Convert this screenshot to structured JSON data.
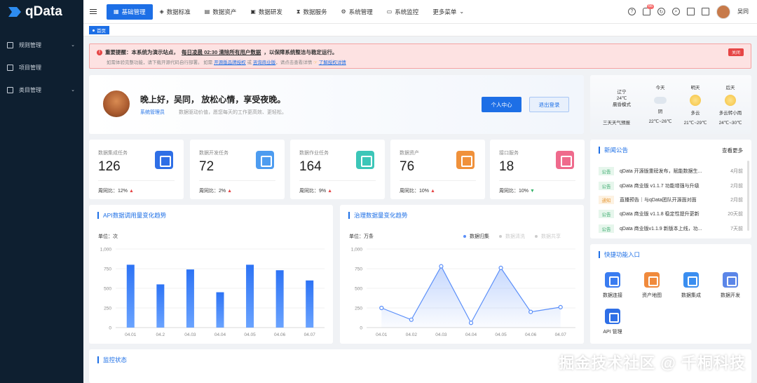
{
  "app": {
    "name": "qData"
  },
  "sidebar": {
    "items": [
      {
        "label": "规则管理",
        "has_children": true
      },
      {
        "label": "项目管理",
        "has_children": false
      },
      {
        "label": "类目管理",
        "has_children": true
      }
    ]
  },
  "topnav": {
    "items": [
      {
        "label": "基础管理",
        "icon": "grid-icon",
        "active": true
      },
      {
        "label": "数据标准",
        "icon": "layers-icon",
        "active": false
      },
      {
        "label": "数据资产",
        "icon": "database-icon",
        "active": false
      },
      {
        "label": "数据研发",
        "icon": "code-icon",
        "active": false
      },
      {
        "label": "数据服务",
        "icon": "hourglass-icon",
        "active": false
      },
      {
        "label": "系统管理",
        "icon": "settings-icon",
        "active": false
      },
      {
        "label": "系统监控",
        "icon": "monitor-icon",
        "active": false
      },
      {
        "label": "更多菜单",
        "icon": "chevron-down-icon",
        "active": false
      }
    ],
    "badge_count": "66",
    "user": "吴同"
  },
  "tags": {
    "home": "首页"
  },
  "alert": {
    "prefix": "重要提醒：本系统为演示站点，",
    "highlight": "每日凌晨 02:30 清除所有用户数据",
    "suffix": "，以保障系统整洁与稳定运行。",
    "line2_a": "如需体验完整功能，请下载开源代码自行部署。 如需",
    "link1": "开源版品牌授权",
    "line2_b": "或",
    "link2": "咨询商业版",
    "line2_c": "，请点击查看详情",
    "link3": "了解授权详情",
    "close": "关闭"
  },
  "welcome": {
    "greeting": "晚上好，吴同， 放松心情，享受夜晚。",
    "role": "系统管理员",
    "subtitle": "数据驱动价值，愿您每天的工作更高效、更轻松。",
    "btn_profile": "个人中心",
    "btn_logout": "退出登录"
  },
  "weather": {
    "city": "辽宁",
    "temp": "24℃",
    "desc": "晨昏模式",
    "forecast_title": "三天天气预报",
    "days": [
      {
        "label": "今天",
        "cond": "阴",
        "range": "22℃~26℃"
      },
      {
        "label": "明天",
        "cond": "多云",
        "range": "21℃~29℃"
      },
      {
        "label": "后天",
        "cond": "多云转小雨",
        "range": "24℃~30℃"
      }
    ]
  },
  "stats": [
    {
      "label": "数据集成任务",
      "value": "126",
      "trend_label": "周同比：",
      "trend": "12%",
      "dir": "up",
      "color": "#2f6fe6"
    },
    {
      "label": "数据开发任务",
      "value": "72",
      "trend_label": "周同比：",
      "trend": "2%",
      "dir": "up",
      "color": "#4d9cf0"
    },
    {
      "label": "数据作业任务",
      "value": "164",
      "trend_label": "周同比：",
      "trend": "9%",
      "dir": "up",
      "color": "#3cc6b8"
    },
    {
      "label": "数据资产",
      "value": "76",
      "trend_label": "周同比：",
      "trend": "10%",
      "dir": "up",
      "color": "#f0913b"
    },
    {
      "label": "接口服务",
      "value": "18",
      "trend_label": "周同比：",
      "trend": "10%",
      "dir": "down",
      "color": "#ef6a8c"
    }
  ],
  "chart_data": [
    {
      "type": "bar",
      "title": "API数据调用量变化趋势",
      "unit": "单位：次",
      "categories": [
        "04.01",
        "04.2",
        "04.03",
        "04.04",
        "04.05",
        "04.06",
        "04.07"
      ],
      "values": [
        800,
        550,
        740,
        450,
        800,
        730,
        600
      ],
      "ylim": [
        0,
        1000
      ],
      "yticks": [
        "0",
        "250",
        "500",
        "750",
        "1,000"
      ],
      "grid": true,
      "color": "#2d73f5"
    },
    {
      "type": "area",
      "title": "治理数据量变化趋势",
      "unit": "单位：万条",
      "categories": [
        "04.01",
        "04.02",
        "04.03",
        "04.04",
        "04.05",
        "04.06",
        "04.07"
      ],
      "series": [
        {
          "name": "数据归集",
          "values": [
            250,
            100,
            780,
            60,
            760,
            200,
            260
          ]
        }
      ],
      "legend": [
        {
          "name": "数据归集",
          "active": true
        },
        {
          "name": "数据清洗",
          "active": false
        },
        {
          "name": "数据共享",
          "active": false
        }
      ],
      "legend_position": "top-right",
      "ylim": [
        0,
        1000
      ],
      "yticks": [
        "0",
        "250",
        "500",
        "750",
        "1,000"
      ],
      "grid": true,
      "color": "#5b8ff9"
    }
  ],
  "news": {
    "title": "新闻公告",
    "more": "查看更多",
    "items": [
      {
        "tag": "公告",
        "type": "green",
        "text": "qData 开源版重磅发布，赋能数据生...",
        "date": "4月前"
      },
      {
        "tag": "公告",
        "type": "green",
        "text": "qData 商业版 v1.1.7 功能增强与升级",
        "date": "2月前"
      },
      {
        "tag": "通知",
        "type": "orange",
        "text": "直播预告｜与qData团队开源面对面",
        "date": "2月前"
      },
      {
        "tag": "公告",
        "type": "green",
        "text": "qData 商业版 v1.1.8 稳定性提升更新",
        "date": "20天前"
      },
      {
        "tag": "公告",
        "type": "green",
        "text": "qData 商业版v1.1.9 新版本上线，功...",
        "date": "7天前"
      }
    ]
  },
  "quick": {
    "title": "快捷功能入口",
    "items": [
      {
        "label": "数据连接",
        "color": "#3a7cf0"
      },
      {
        "label": "资产地图",
        "color": "#f08a3c"
      },
      {
        "label": "数据集成",
        "color": "#3a8ef0"
      },
      {
        "label": "数据开发",
        "color": "#5b86e8"
      },
      {
        "label": "API 管理",
        "color": "#2f6fe6"
      }
    ]
  },
  "monitor": {
    "title": "监控状态"
  },
  "watermark": "掘金技术社区 @ 千桐科技"
}
